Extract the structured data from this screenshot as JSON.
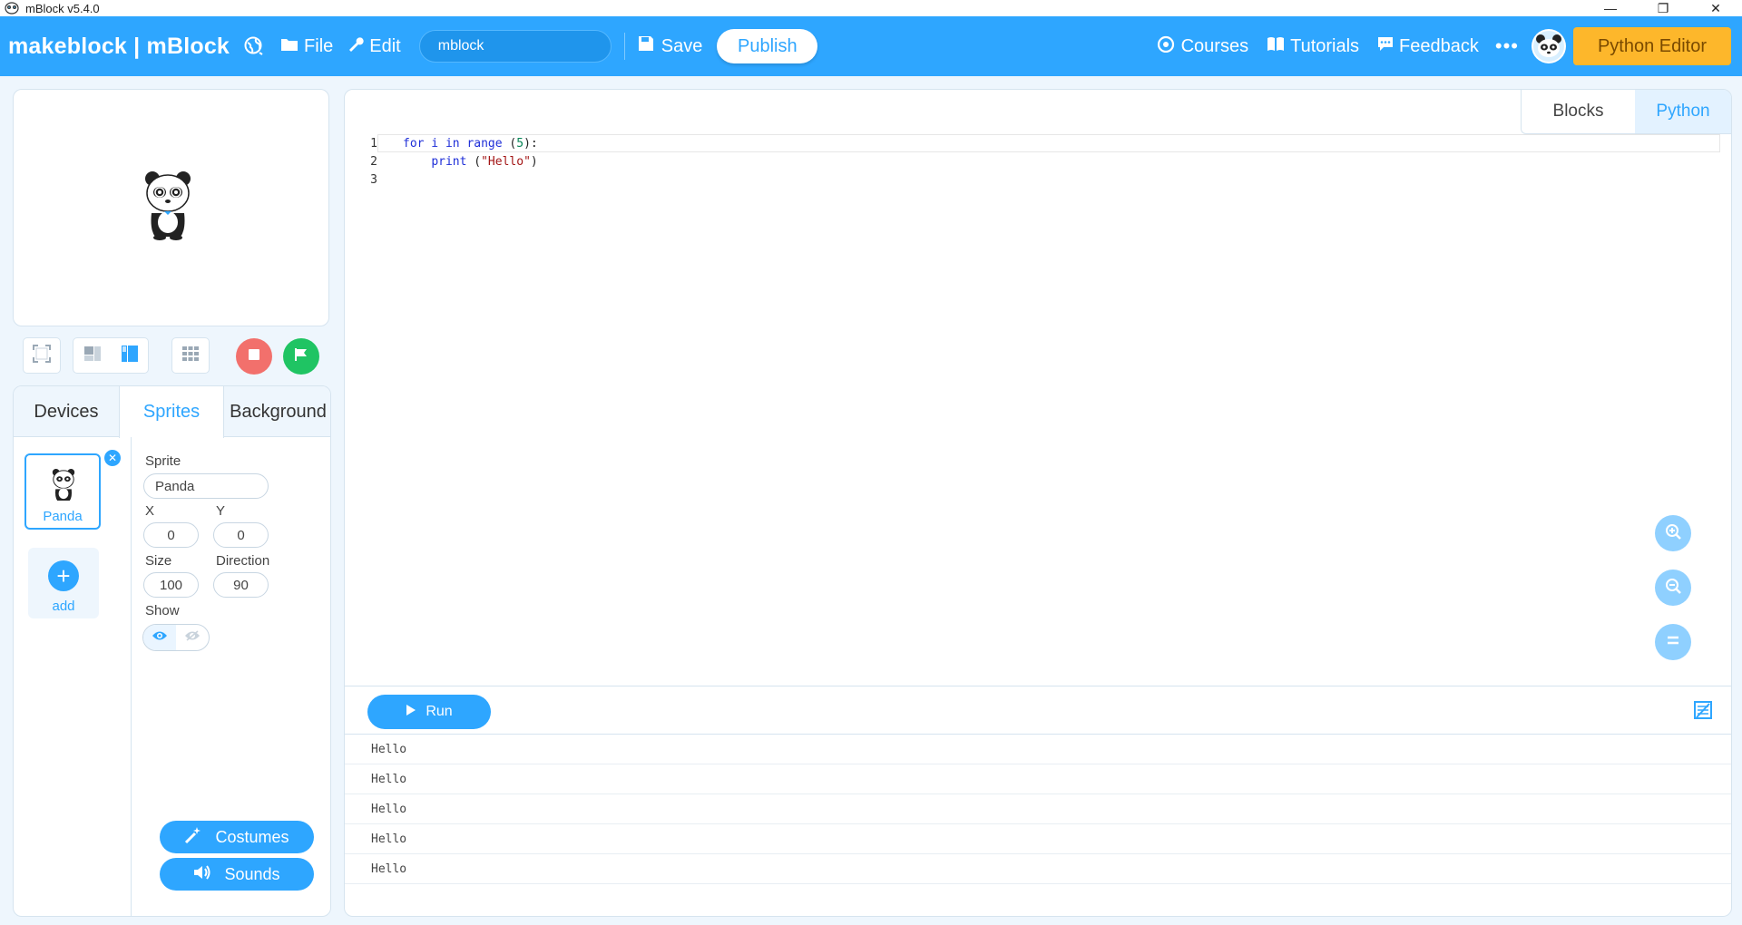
{
  "window": {
    "title": "mBlock v5.4.0",
    "minimize": "—",
    "restore": "❐",
    "close": "✕"
  },
  "menubar": {
    "brand": "makeblock | mBlock",
    "file_label": "File",
    "edit_label": "Edit",
    "project_name": "mblock",
    "save_label": "Save",
    "publish_label": "Publish",
    "courses_label": "Courses",
    "tutorials_label": "Tutorials",
    "feedback_label": "Feedback",
    "more_label": "•••",
    "python_editor_label": "Python Editor"
  },
  "colors": {
    "accent": "#2ea6ff",
    "python_editor": "#fdb72b",
    "stop": "#f2706c",
    "go": "#1fc463"
  },
  "panel_tabs": {
    "devices": "Devices",
    "sprites": "Sprites",
    "background": "Background"
  },
  "sprite_list": {
    "selected_sprite": "Panda",
    "add_label": "add"
  },
  "sprite_props": {
    "sprite_label": "Sprite",
    "sprite_value": "Panda",
    "x_label": "X",
    "x_value": "0",
    "y_label": "Y",
    "y_value": "0",
    "size_label": "Size",
    "size_value": "100",
    "direction_label": "Direction",
    "direction_value": "90",
    "show_label": "Show",
    "costumes_label": "Costumes",
    "sounds_label": "Sounds"
  },
  "editor": {
    "blocks_tab": "Blocks",
    "python_tab": "Python",
    "line_numbers": [
      "1",
      "2",
      "3"
    ],
    "code": {
      "l1_kw1": "for",
      "l1_var": " i ",
      "l1_kw2": "in",
      "l1_fn": " range ",
      "l1_open": "(",
      "l1_num": "5",
      "l1_close": "):",
      "l2_indent": "    ",
      "l2_fn": "print",
      "l2_open": " (",
      "l2_str": "\"Hello\"",
      "l2_close": ")"
    },
    "run_label": "Run",
    "console_output": [
      "Hello",
      "Hello",
      "Hello",
      "Hello",
      "Hello"
    ]
  }
}
